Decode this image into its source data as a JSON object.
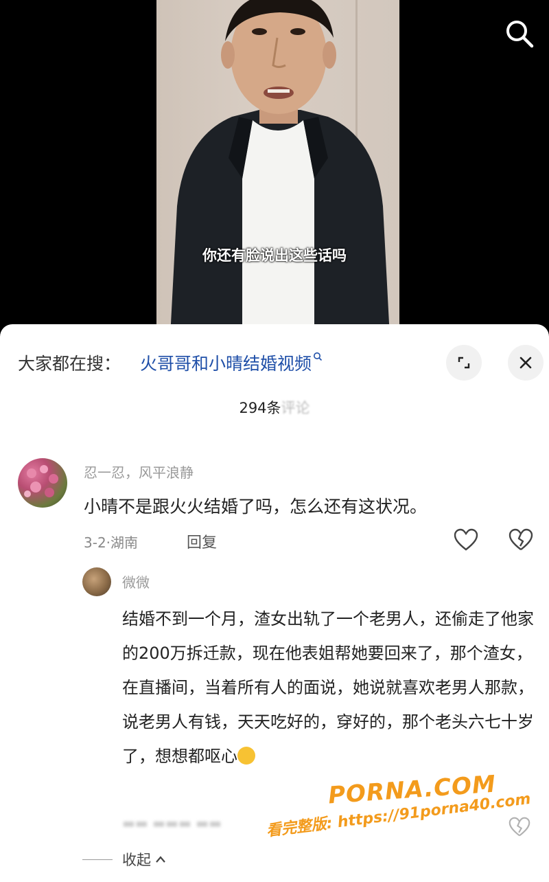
{
  "video": {
    "subtitle": "你还有脸说出这些话吗"
  },
  "header": {
    "trending_prefix": "大家都在搜：",
    "trending_query": "火哥哥和小晴结婚视频",
    "comment_count": "294条",
    "comment_count_suffix": "评论"
  },
  "comments": [
    {
      "username": "忍一忍，风平浪静",
      "text": "小晴不是跟火火结婚了吗，怎么还有这状况。",
      "date_location": "3-2·湖南",
      "reply_label": "回复",
      "replies": [
        {
          "username": "微微",
          "text": "结婚不到一个月，渣女出轨了一个老男人，还偷走了他家的200万拆迁款，现在他表姐帮她要回来了，那个渣女，在直播间，当着所有人的面说，她说就喜欢老男人那款，说老男人有钱，天天吃好的，穿好的，那个老头六七十岁了，想想都呕心"
        }
      ],
      "collapse_label": "收起"
    }
  ],
  "watermark": {
    "brand": "PORNA.COM",
    "url": "看完整版: https://91porna40.com"
  },
  "colors": {
    "link": "#1f4fa8",
    "watermark": "#f39b1c"
  },
  "icons": [
    "search-icon",
    "expand-icon",
    "close-icon",
    "heart-icon",
    "broken-heart-icon",
    "chevron-up-icon"
  ]
}
